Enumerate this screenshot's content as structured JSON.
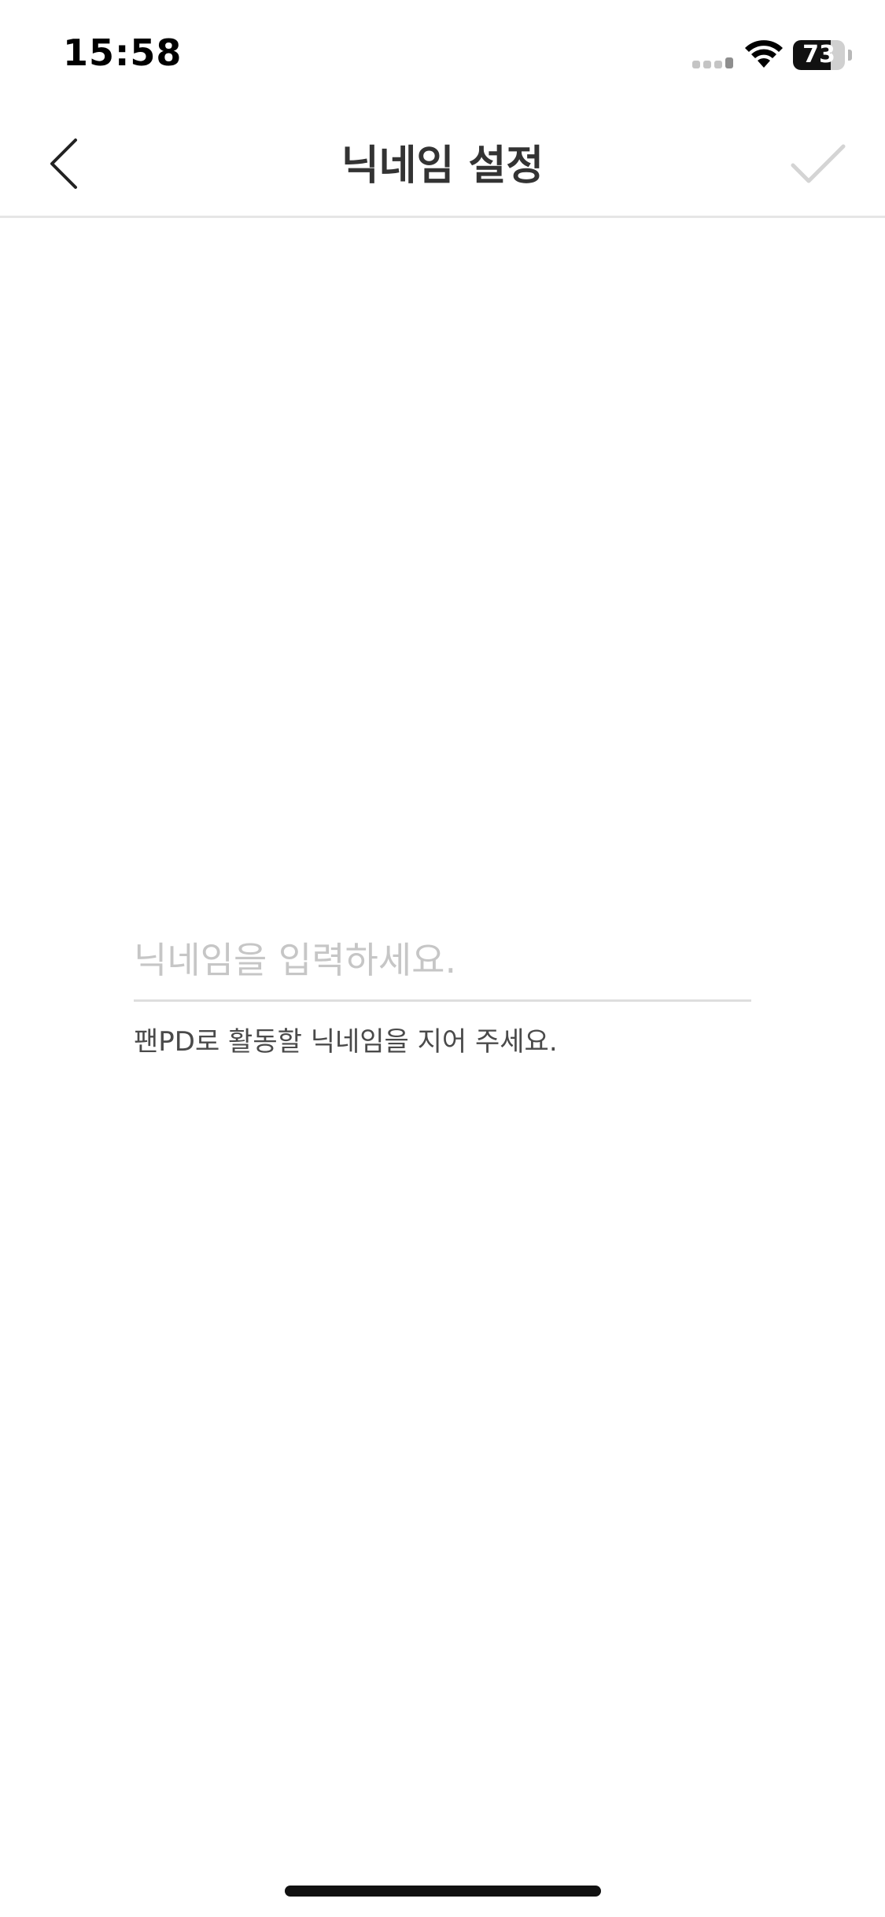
{
  "status_bar": {
    "time": "15:58",
    "battery_level": "73",
    "battery_fraction": 0.73
  },
  "nav": {
    "title": "닉네임 설정",
    "back_icon": "chevron-left-icon",
    "confirm_icon": "checkmark-icon"
  },
  "form": {
    "nickname_value": "",
    "nickname_placeholder": "닉네임을 입력하세요.",
    "helper_text": "팬PD로 활동할 닉네임을 지어 주세요."
  },
  "colors": {
    "title": "#333333",
    "placeholder": "#c6c6c6",
    "confirm_disabled": "#d4d4d4",
    "divider": "#e6e6e6"
  }
}
